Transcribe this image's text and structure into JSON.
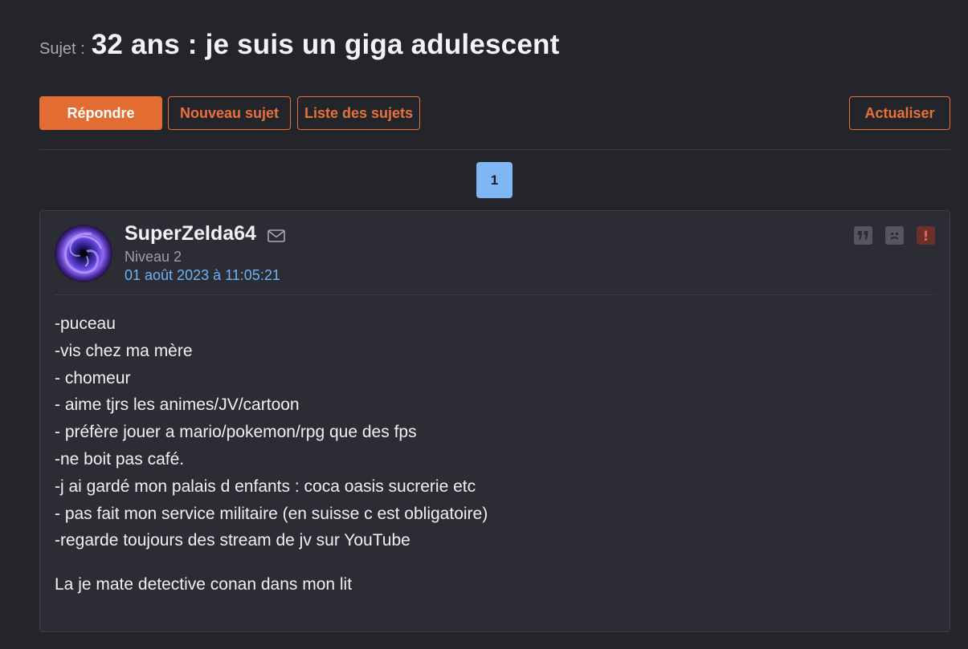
{
  "topic": {
    "prefix": "Sujet :",
    "title": "32 ans : je suis un giga adulescent"
  },
  "toolbar": {
    "reply_label": "Répondre",
    "new_topic_label": "Nouveau sujet",
    "topic_list_label": "Liste des sujets",
    "refresh_label": "Actualiser"
  },
  "pagination": {
    "current_page": "1"
  },
  "post": {
    "author": "SuperZelda64",
    "level": "Niveau 2",
    "date": "01 août 2023 à 11:05:21",
    "lines": [
      "-puceau",
      "-vis chez ma mère",
      "- chomeur",
      "- aime tjrs les animes/JV/cartoon",
      "- préfère jouer a mario/pokemon/rpg que des fps",
      "-ne boit pas café.",
      "-j ai gardé mon palais d enfants : coca oasis sucrerie etc",
      "- pas fait mon service militaire (en suisse c est obligatoire)",
      "-regarde toujours des stream de jv sur YouTube"
    ],
    "closing": "La je mate detective conan dans mon lit",
    "icons": {
      "mail": "envelope-icon",
      "quote": "quote-icon",
      "mp": "frown-face-icon",
      "report": "alert-icon"
    }
  },
  "colors": {
    "background": "#24252a",
    "panel": "#2c2d34",
    "accent_orange": "#e36c32",
    "link_blue": "#6fb2f5",
    "active_page": "#7fb7f5"
  }
}
